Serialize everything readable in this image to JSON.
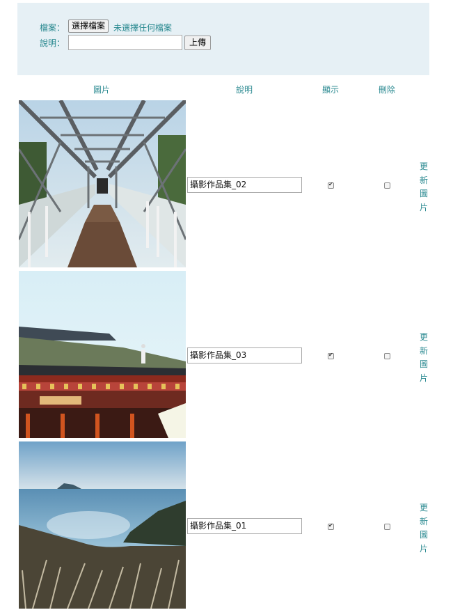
{
  "upload": {
    "file_label": "檔案：",
    "file_button": "選擇檔案",
    "file_status": "未選擇任何檔案",
    "desc_label": "說明：",
    "desc_value": "",
    "upload_button": "上傳"
  },
  "table": {
    "headers": {
      "image": "圖片",
      "caption": "說明",
      "show": "顯示",
      "delete": "刪除"
    },
    "rows": [
      {
        "caption": "攝影作品集_02",
        "show": true,
        "delete": false,
        "action": "更新圖片"
      },
      {
        "caption": "攝影作品集_03",
        "show": true,
        "delete": false,
        "action": "更新圖片"
      },
      {
        "caption": "攝影作品集_01",
        "show": true,
        "delete": false,
        "action": "更新圖片"
      }
    ]
  },
  "colors": {
    "accent": "#2b8a91",
    "panel_bg": "#e6f0f5"
  }
}
